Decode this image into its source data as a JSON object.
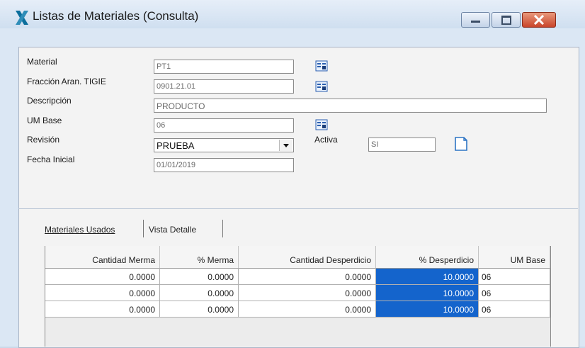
{
  "window": {
    "title": "Listas de Materiales (Consulta)"
  },
  "form": {
    "material": {
      "label": "Material",
      "value": "PT1"
    },
    "fraccion": {
      "label": "Fracción Aran. TIGIE",
      "value": "0901.21.01"
    },
    "descripcion": {
      "label": "Descripción",
      "value": "PRODUCTO"
    },
    "um_base": {
      "label": "UM Base",
      "value": "06"
    },
    "revision": {
      "label": "Revisión",
      "value": "PRUEBA"
    },
    "activa": {
      "label": "Activa",
      "value": "SI"
    },
    "fecha_inicial": {
      "label": "Fecha Inicial",
      "value": "01/01/2019"
    }
  },
  "tabs": [
    {
      "label": "Materiales Usados"
    },
    {
      "label": "Vista Detalle"
    }
  ],
  "grid": {
    "columns": [
      "Cantidad Merma",
      "% Merma",
      "Cantidad Desperdicio",
      "% Desperdicio",
      "UM Base"
    ],
    "rows": [
      [
        "0.0000",
        "0.0000",
        "0.0000",
        "10.0000",
        "06"
      ],
      [
        "0.0000",
        "0.0000",
        "0.0000",
        "10.0000",
        "06"
      ],
      [
        "0.0000",
        "0.0000",
        "0.0000",
        "10.0000",
        "06"
      ]
    ]
  },
  "colors": {
    "title_bar": "#dbe7f4",
    "selected_cell": "#1464cc",
    "close_button": "#c9442a"
  },
  "icons": {
    "app": "x-logo-icon",
    "lookup": "lookup-list-icon",
    "page": "page-icon"
  }
}
